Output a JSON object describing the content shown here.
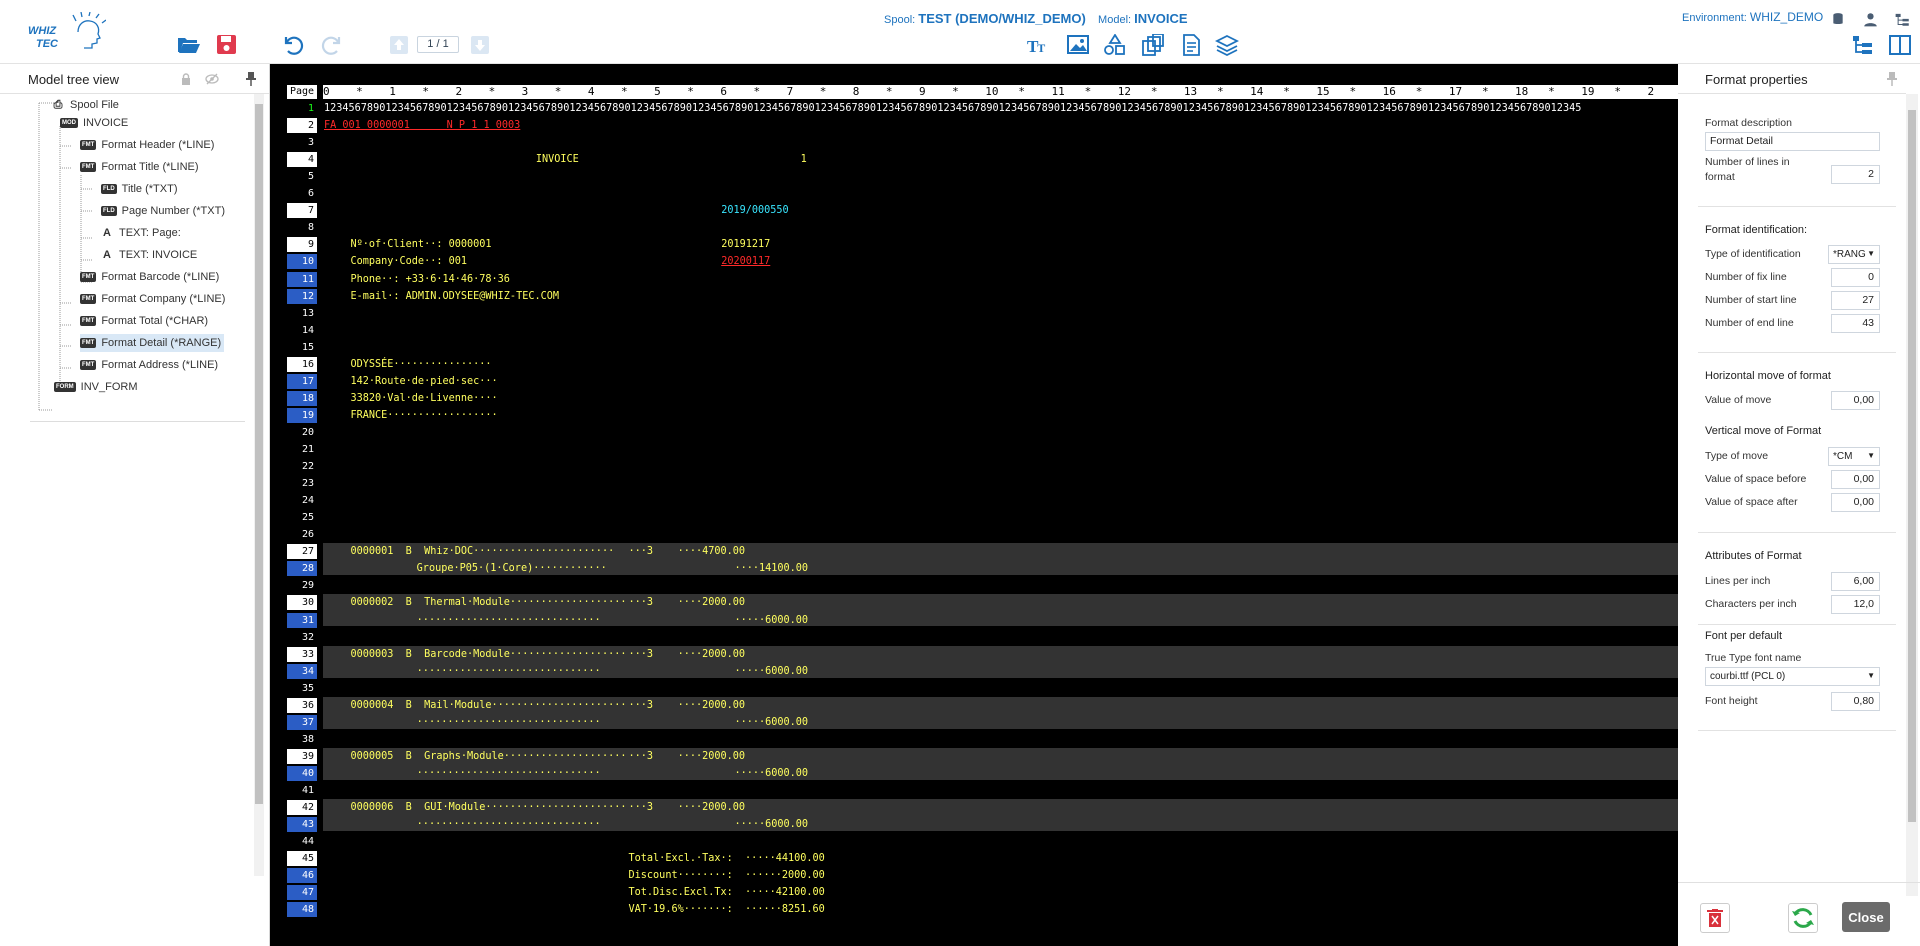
{
  "header": {
    "spool_label": "Spool:",
    "spool_value": "TEST (DEMO/WHIZ_DEMO)",
    "model_label": "Model:",
    "model_value": "INVOICE",
    "env_label": "Environment:",
    "env_value": "WHIZ_DEMO",
    "page_indicator": "1 / 1",
    "logo_text_1": "WHIZ",
    "logo_text_2": "TEC"
  },
  "icons": {
    "open": "folder-open-icon",
    "save": "save-icon",
    "undo": "undo-icon",
    "redo": "redo-icon",
    "prev": "arrow-up-icon",
    "next": "arrow-down-icon",
    "text": "text-size-icon",
    "image": "image-icon",
    "shapes": "shapes-icon",
    "copy": "copy-icon",
    "document": "document-icon",
    "layers": "layers-icon",
    "database": "database-icon",
    "user": "user-icon",
    "tree": "tree-view-icon",
    "split": "split-view-icon"
  },
  "left_panel": {
    "title": "Model tree view",
    "tree": [
      {
        "label": "Spool File",
        "badge": "",
        "glyph": "print"
      },
      {
        "label": "INVOICE",
        "badge": "MOD",
        "glyph": ""
      },
      {
        "label": "Format Header (*LINE)",
        "badge": "FMT",
        "glyph": ""
      },
      {
        "label": "Format Title (*LINE)",
        "badge": "FMT",
        "glyph": ""
      },
      {
        "label": "Title (*TXT)",
        "badge": "FLD",
        "glyph": ""
      },
      {
        "label": "Page Number (*TXT)",
        "badge": "FLD",
        "glyph": ""
      },
      {
        "label": "TEXT: Page:",
        "badge": "",
        "glyph": "A"
      },
      {
        "label": "TEXT: INVOICE",
        "badge": "",
        "glyph": "A"
      },
      {
        "label": "Format Barcode (*LINE)",
        "badge": "FMT",
        "glyph": ""
      },
      {
        "label": "Format Company (*LINE)",
        "badge": "FMT",
        "glyph": ""
      },
      {
        "label": "Format Total (*CHAR)",
        "badge": "FMT",
        "glyph": ""
      },
      {
        "label": "Format Detail (*RANGE)",
        "badge": "FMT",
        "glyph": ""
      },
      {
        "label": "Format Address (*LINE)",
        "badge": "FMT",
        "glyph": ""
      },
      {
        "label": "INV_FORM",
        "badge": "FORM",
        "glyph": ""
      }
    ]
  },
  "editor": {
    "page_label": "Page",
    "ruler": "0    *    1    *    2    *    3    *    4    *    5    *    6    *    7    *    8    *    9    *    10   *    11   *    12   *    13   *    14   *    15   *    16   *    17   *    18   *    19   *    2",
    "lines": [
      {
        "n": "1",
        "t": "1234567890123456789012345678901234567890123456789012345678901234567890123456789012345678901234567890123456789012345678901234567890123456789012345678901234567890123456789012345678901234567890123456789012345"
      },
      {
        "n": "2",
        "t": "FA 001 0000001      N P 1 1 0003"
      },
      {
        "n": "3",
        "t": ""
      },
      {
        "n": "4",
        "t": "INVOICE",
        "t2": "1"
      },
      {
        "n": "5",
        "t": ""
      },
      {
        "n": "6",
        "t": ""
      },
      {
        "n": "7",
        "t": "2019/000550"
      },
      {
        "n": "8",
        "t": ""
      },
      {
        "n": "9",
        "t": "Nº·of·Client··: 0000001",
        "t2": "20191217"
      },
      {
        "n": "10",
        "t": "Company·Code··: 001",
        "t2": "20200117"
      },
      {
        "n": "11",
        "t": "Phone··: +33·6·14·46·78·36"
      },
      {
        "n": "12",
        "t": "E-mail·: ADMIN.ODYSEE@WHIZ-TEC.COM"
      },
      {
        "n": "13",
        "t": ""
      },
      {
        "n": "14",
        "t": ""
      },
      {
        "n": "15",
        "t": ""
      },
      {
        "n": "16",
        "t": "ODYSSÉE················"
      },
      {
        "n": "17",
        "t": "142·Route·de·pied·sec···"
      },
      {
        "n": "18",
        "t": "33820·Val·de·Livenne····"
      },
      {
        "n": "19",
        "t": "FRANCE··················"
      },
      {
        "n": "20",
        "t": ""
      },
      {
        "n": "21",
        "t": ""
      },
      {
        "n": "22",
        "t": ""
      },
      {
        "n": "23",
        "t": ""
      },
      {
        "n": "24",
        "t": ""
      },
      {
        "n": "25",
        "t": ""
      },
      {
        "n": "26",
        "t": ""
      },
      {
        "n": "27",
        "t": "0000001  B  Whiz·DOC·······················",
        "t2": "···3    ····4700.00"
      },
      {
        "n": "28",
        "t": "Groupe·P05·(1·Core)············",
        "t2": "····14100.00"
      },
      {
        "n": "29",
        "t": ""
      },
      {
        "n": "30",
        "t": "0000002  B  Thermal·Module···················",
        "t2": "···3    ····2000.00"
      },
      {
        "n": "31",
        "t": "······························",
        "t2": "·····6000.00"
      },
      {
        "n": "32",
        "t": ""
      },
      {
        "n": "33",
        "t": "0000003  B  Barcode·Module···················",
        "t2": "···3    ····2000.00"
      },
      {
        "n": "34",
        "t": "······························",
        "t2": "·····6000.00"
      },
      {
        "n": "35",
        "t": ""
      },
      {
        "n": "36",
        "t": "0000004  B  Mail·Module······················",
        "t2": "···3    ····2000.00"
      },
      {
        "n": "37",
        "t": "······························",
        "t2": "·····6000.00"
      },
      {
        "n": "38",
        "t": ""
      },
      {
        "n": "39",
        "t": "0000005  B  Graphs·Module····················",
        "t2": "···3    ····2000.00"
      },
      {
        "n": "40",
        "t": "······························",
        "t2": "·····6000.00"
      },
      {
        "n": "41",
        "t": ""
      },
      {
        "n": "42",
        "t": "0000006  B  GUI·Module·······················",
        "t2": "···3    ····2000.00"
      },
      {
        "n": "43",
        "t": "······························",
        "t2": "·····6000.00"
      },
      {
        "n": "44",
        "t": ""
      },
      {
        "n": "45",
        "t": "Total·Excl.·Tax·:  ·····44100.00"
      },
      {
        "n": "46",
        "t": "Discount········:  ······2000.00"
      },
      {
        "n": "47",
        "t": "Tot.Disc.Excl.Tx:  ·····42100.00"
      },
      {
        "n": "48",
        "t": "VAT·19.6%·······:  ······8251.60"
      }
    ]
  },
  "props": {
    "title": "Format properties",
    "desc_label": "Format description",
    "desc_value": "Format Detail",
    "nlines_label_1": "Number of lines in",
    "nlines_label_2": "format",
    "nlines_value": "2",
    "ident_head": "Format identification:",
    "type_ident_label": "Type of identification",
    "type_ident_value": "*RANG",
    "fix_label": "Number of fix line",
    "fix_value": "0",
    "start_label": "Number of start line",
    "start_value": "27",
    "end_label": "Number of end line",
    "end_value": "43",
    "hmove_head": "Horizontal move of format",
    "hmove_label": "Value of move",
    "hmove_value": "0,00",
    "vmove_head": "Vertical move of Format",
    "vtype_label": "Type of move",
    "vtype_value": "*CM",
    "vbefore_label": "Value of space before",
    "vbefore_value": "0,00",
    "vafter_label": "Value of space after",
    "vafter_value": "0,00",
    "attr_head": "Attributes of Format",
    "lpi_label": "Lines per inch",
    "lpi_value": "6,00",
    "cpi_label": "Characters per inch",
    "cpi_value": "12,0",
    "font_head": "Font per default",
    "ttf_label": "True Type font name",
    "ttf_value": "courbi.ttf (PCL 0)",
    "fh_label": "Font height",
    "fh_value": "0,80",
    "close_label": "Close"
  }
}
